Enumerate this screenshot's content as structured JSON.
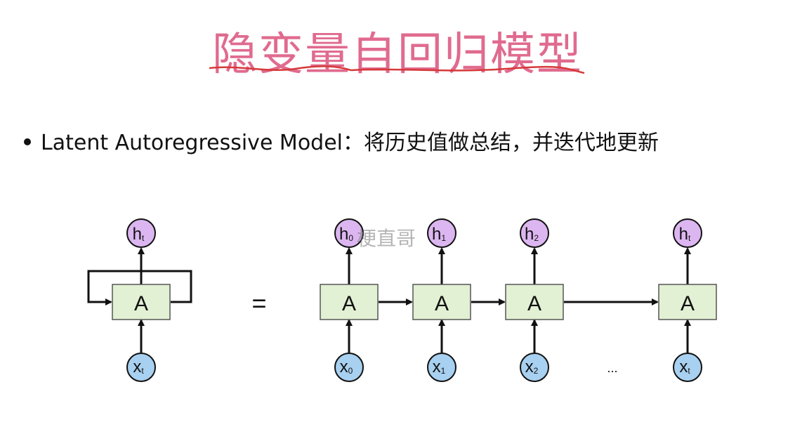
{
  "title": "隐变量自回归模型",
  "bullet": {
    "label": "Latent Autoregressive Model",
    "separator": "：",
    "description": "将历史值做总结，并迭代地更新"
  },
  "watermark": "梗直哥",
  "diagram": {
    "cell_label": "A",
    "equals": "=",
    "ellipsis": "...",
    "rolled": {
      "h": "h",
      "h_sub": "t",
      "x": "x",
      "x_sub": "t"
    },
    "unrolled": [
      {
        "h": "h",
        "h_sub": "0",
        "x": "x",
        "x_sub": "0"
      },
      {
        "h": "h",
        "h_sub": "1",
        "x": "x",
        "x_sub": "1"
      },
      {
        "h": "h",
        "h_sub": "2",
        "x": "x",
        "x_sub": "2"
      },
      {
        "h": "h",
        "h_sub": "t",
        "x": "x",
        "x_sub": "t"
      }
    ],
    "colors": {
      "cell_fill": "#e2f0d4",
      "cell_stroke": "#555555",
      "h_fill": "#dcb6f0",
      "x_fill": "#a8d0f0",
      "arrow": "#111111",
      "title": "#e06b8f",
      "underline": "#d63a3a"
    }
  }
}
